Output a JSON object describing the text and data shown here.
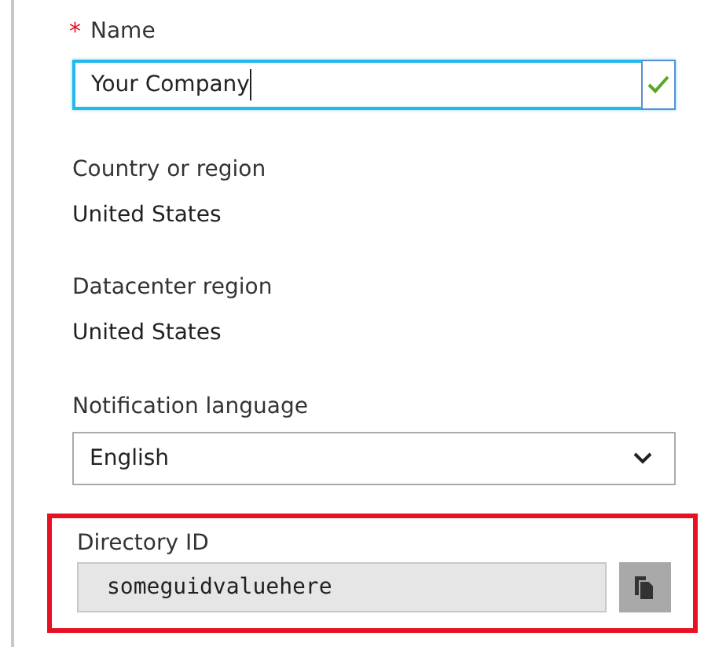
{
  "fields": [
    {
      "kind": "input",
      "label": "Name",
      "required_mark": "*",
      "value": "Your Company",
      "valid": true,
      "focused": true
    },
    {
      "kind": "info",
      "label": "Country or region",
      "value": "United States"
    },
    {
      "kind": "info",
      "label": "Datacenter region",
      "value": "United States"
    },
    {
      "kind": "select",
      "label": "Notification language",
      "value": "English"
    },
    {
      "kind": "readonly",
      "label": "Directory ID",
      "value": "someguidvaluehere",
      "highlighted": true
    }
  ]
}
